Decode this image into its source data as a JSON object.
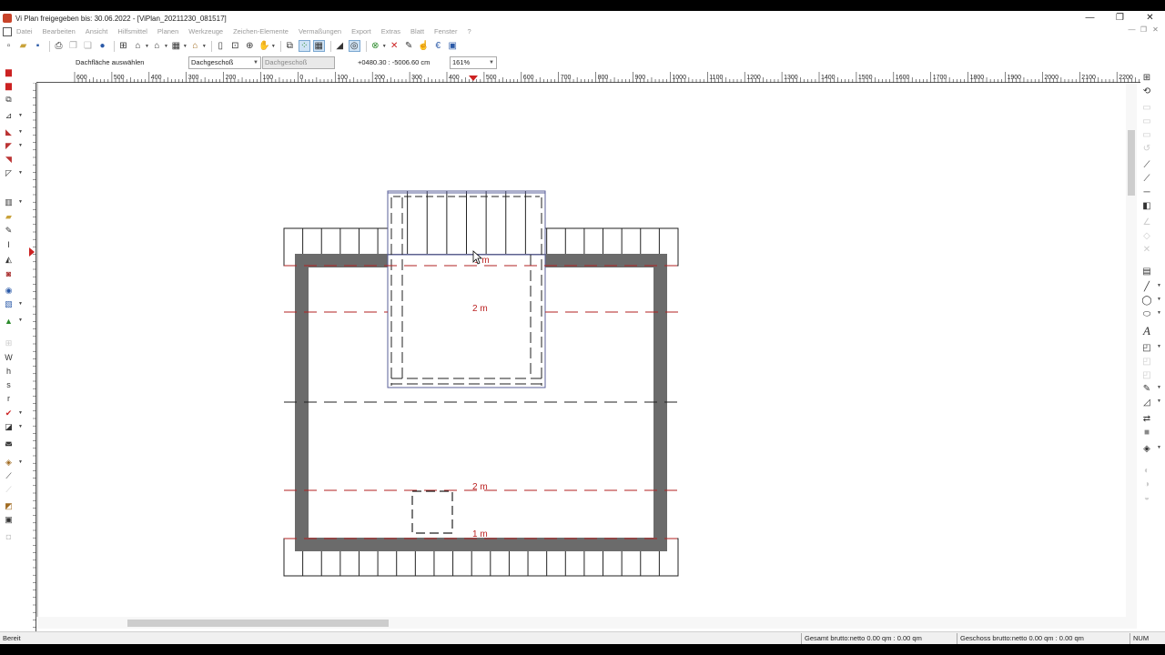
{
  "window": {
    "title": "Vi Plan freigegeben bis: 30.06.2022 - [ViPlan_20211230_081517]",
    "minimize": "—",
    "maximize": "❐",
    "close": "✕"
  },
  "menu": {
    "items": [
      "Datei",
      "Bearbeiten",
      "Ansicht",
      "Hilfsmittel",
      "Planen",
      "Werkzeuge",
      "Zeichen-Elemente",
      "Vermaßungen",
      "Export",
      "Extras",
      "Blatt",
      "Fenster",
      "?"
    ],
    "mdi": [
      "—",
      "❐",
      "✕"
    ]
  },
  "propbar": {
    "label": "Dachfläche auswählen",
    "floor_select": "Dachgeschoß",
    "floor_select_disabled": "Dachgeschoß",
    "coords": "+0480.30 : -5006.60 cm",
    "zoom": "161%"
  },
  "ruler": {
    "h_ticks": [
      "600",
      "500",
      "400",
      "300",
      "200",
      "100",
      "0",
      "100",
      "200",
      "300",
      "400",
      "500",
      "600",
      "700",
      "800",
      "900",
      "1000",
      "1100",
      "1200",
      "1300",
      "1400",
      "1500",
      "1600",
      "1700",
      "1800",
      "1900",
      "2000",
      "2100",
      "2200"
    ]
  },
  "drawing": {
    "dim_labels": [
      "1 m",
      "2 m",
      "2 m",
      "1 m"
    ],
    "wall_color": "#6b6b6b",
    "dim_color": "#b22222",
    "dormer_color": "#5a5f9a"
  },
  "status": {
    "left": "Bereit",
    "gesamt": "Gesamt brutto:netto 0.00 qm : 0.00 qm",
    "geschoss": "Geschoss brutto:netto 0.00 qm : 0.00 qm",
    "num": "NUM"
  },
  "icons": {
    "app": "viplan-app-icon",
    "cursor": "mouse-pointer-icon"
  }
}
